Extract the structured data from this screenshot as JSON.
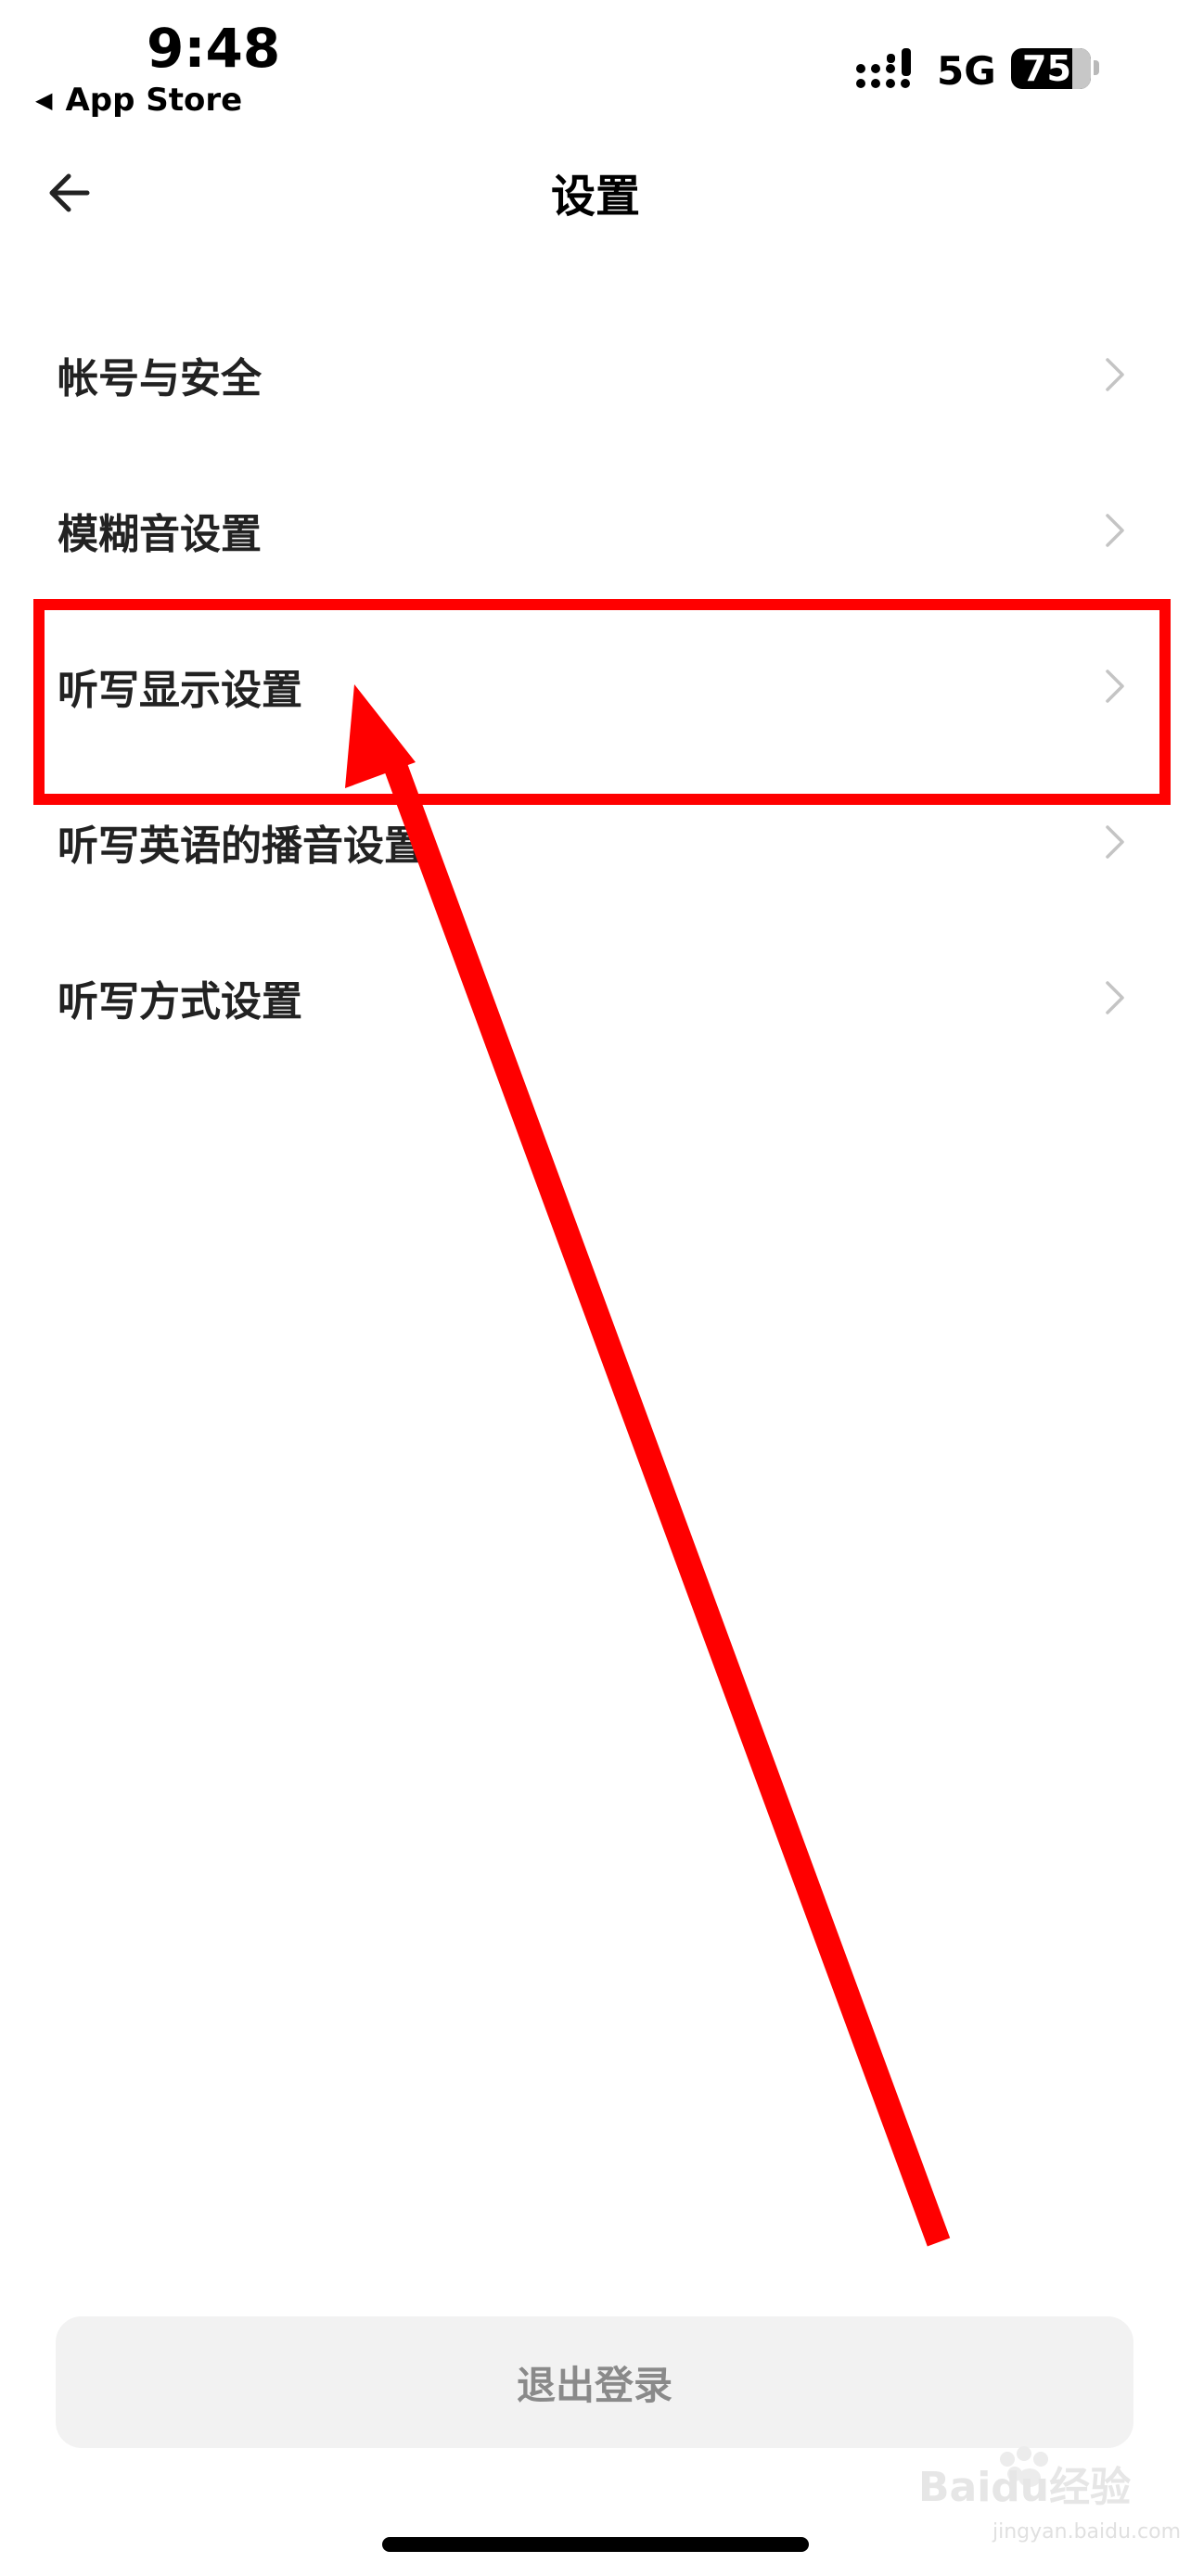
{
  "status_bar": {
    "time": "9:48",
    "back_app": "App Store",
    "network": "5G",
    "battery": "75",
    "battery_level": 0.75
  },
  "nav": {
    "title": "设置",
    "back_icon": "arrow-left-icon"
  },
  "settings_items": [
    {
      "label": "帐号与安全"
    },
    {
      "label": "模糊音设置"
    },
    {
      "label": "听写显示设置"
    },
    {
      "label": "听写英语的播音设置"
    },
    {
      "label": "听写方式设置"
    }
  ],
  "logout": {
    "label": "退出登录"
  },
  "watermark": {
    "text": "Baidu经验",
    "sub": "jingyan.baidu.com"
  },
  "annotation": {
    "color": "#ff0000",
    "highlighted_item": "听写显示设置"
  }
}
